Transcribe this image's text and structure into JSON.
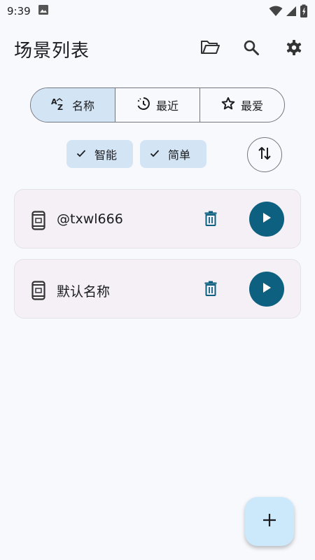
{
  "status_bar": {
    "time": "9:39"
  },
  "app_bar": {
    "title": "场景列表",
    "icons": [
      "folder-open-icon",
      "search-icon",
      "settings-icon"
    ]
  },
  "sort_segments": [
    {
      "label": "名称",
      "icon": "sort-az-icon",
      "selected": true
    },
    {
      "label": "最近",
      "icon": "recent-clock-icon",
      "selected": false
    },
    {
      "label": "最爱",
      "icon": "star-outline-icon",
      "selected": false
    }
  ],
  "filters": [
    {
      "label": "智能",
      "checked": true
    },
    {
      "label": "简单",
      "checked": true
    }
  ],
  "scenes": [
    {
      "name": "@txwl666"
    },
    {
      "name": "默认名称"
    }
  ],
  "colors": {
    "accent": "#0e6080",
    "selected_bg": "#d3e4f5",
    "card_bg": "#f5f0f6",
    "fab_bg": "#cce8fb"
  }
}
